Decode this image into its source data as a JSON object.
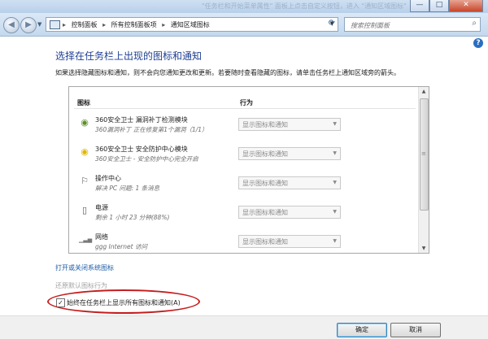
{
  "window": {
    "title_faint": "\"任务栏和开始菜单属性\" 面板上点击自定义按钮，进入 \"通知区域图标\"",
    "minimize": "—",
    "maximize": "□",
    "close": "✕"
  },
  "address": {
    "crumbs": [
      "控制面板",
      "所有控制面板项",
      "通知区域图标"
    ],
    "separator": "▸",
    "search_placeholder": "搜索控制面板"
  },
  "main": {
    "heading": "选择在任务栏上出现的图标和通知",
    "description": "如果选择隐藏图标和通知，则不会向您通知更改和更新。若要随时查看隐藏的图标，请单击任务栏上通知区域旁的箭头。",
    "col_icons": "图标",
    "col_behavior": "行为",
    "rows": [
      {
        "icon": "shield-360-icon",
        "glyph": "◉",
        "color": "#5f8f2a",
        "name": "360安全卫士 漏洞补丁检测模块",
        "sub": "360漏洞补丁 正在修复第1个漏洞（1/1）",
        "behavior": "显示图标和通知"
      },
      {
        "icon": "shield-360-green-icon",
        "glyph": "◉",
        "color": "#e1b700",
        "name": "360安全卫士 安全防护中心模块",
        "sub": "360安全卫士 - 安全防护中心完全开启",
        "behavior": "显示图标和通知"
      },
      {
        "icon": "flag-icon",
        "glyph": "⚐",
        "color": "#555555",
        "name": "操作中心",
        "sub": "解决 PC 问题: 1 条消息",
        "behavior": "显示图标和通知"
      },
      {
        "icon": "battery-icon",
        "glyph": "▯",
        "color": "#555555",
        "name": "电源",
        "sub": "剩余 1 小时 23 分钟(88%)",
        "behavior": "显示图标和通知"
      },
      {
        "icon": "network-icon",
        "glyph": "▁▃▅",
        "color": "#777777",
        "name": "网络",
        "sub": "ggg Internet 访问",
        "behavior": "显示图标和通知"
      }
    ],
    "link_system_icons": "打开或关闭系统图标",
    "link_restore": "还原默认图标行为",
    "always_show_label": "始终在任务栏上显示所有图标和通知(A)",
    "always_show_checked": "✓"
  },
  "footer": {
    "ok": "确定",
    "cancel": "取消"
  },
  "colors": {
    "heading": "#1f3f92",
    "link": "#1a5aa6",
    "highlight_ellipse": "#c41e1e"
  }
}
